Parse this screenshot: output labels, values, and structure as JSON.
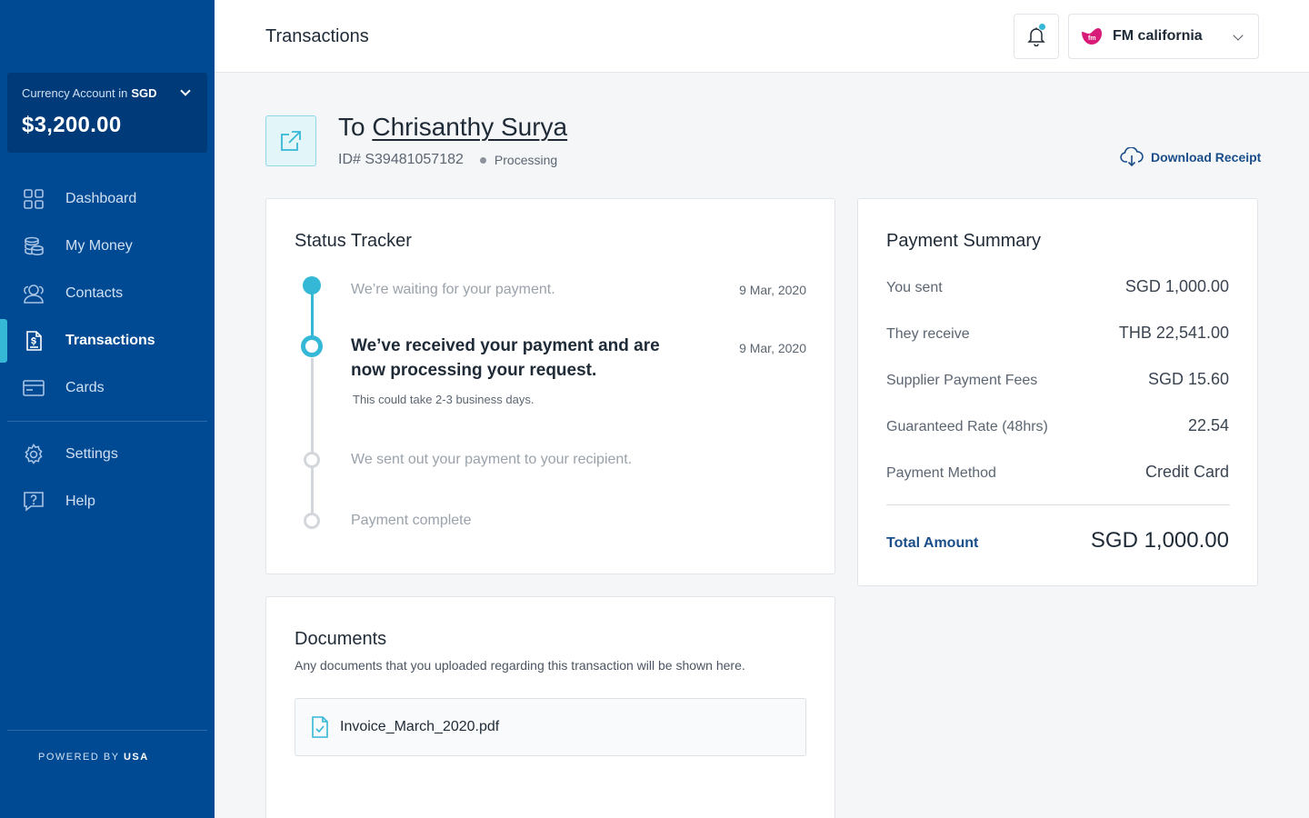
{
  "sidebar": {
    "account_label": "Currency Account in",
    "account_currency": "SGD",
    "balance": "$3,200.00",
    "items": [
      {
        "label": "Dashboard",
        "icon": "dashboard-icon"
      },
      {
        "label": "My Money",
        "icon": "coins-icon"
      },
      {
        "label": "Contacts",
        "icon": "contacts-icon"
      },
      {
        "label": "Transactions",
        "icon": "transactions-icon",
        "active": true
      },
      {
        "label": "Cards",
        "icon": "card-icon"
      },
      {
        "label": "Settings",
        "icon": "gear-icon"
      },
      {
        "label": "Help",
        "icon": "help-icon"
      }
    ],
    "powered_by": "POWERED BY",
    "powered_brand": "USA"
  },
  "header": {
    "title": "Transactions",
    "org_name": "FM california"
  },
  "transaction": {
    "to_prefix": "To",
    "recipient": "Chrisanthy Surya",
    "id": "ID# S39481057182",
    "status": "Processing",
    "download_label": "Download Receipt"
  },
  "tracker": {
    "title": "Status Tracker",
    "steps": [
      {
        "text": "We’re waiting for your payment.",
        "date": "9 Mar, 2020",
        "state": "done"
      },
      {
        "text": "We’ve received your payment and are now processing your request.",
        "date": "9 Mar, 2020",
        "sub": "This could take 2-3 business days.",
        "state": "active"
      },
      {
        "text": "We sent out your payment to your recipient.",
        "state": "pending"
      },
      {
        "text": "Payment complete",
        "state": "pending"
      }
    ]
  },
  "documents": {
    "title": "Documents",
    "description": "Any documents that you uploaded regarding this transaction will be shown here.",
    "files": [
      "Invoice_March_2020.pdf"
    ]
  },
  "summary": {
    "title": "Payment Summary",
    "rows": [
      {
        "label": "You sent",
        "value": "SGD 1,000.00"
      },
      {
        "label": "They receive",
        "value": "THB 22,541.00"
      },
      {
        "label": "Supplier Payment Fees",
        "value": "SGD 15.60"
      },
      {
        "label": "Guaranteed Rate (48hrs)",
        "value": "22.54"
      },
      {
        "label": "Payment Method",
        "value": "Credit Card"
      }
    ],
    "total_label": "Total Amount",
    "total_value": "SGD 1,000.00"
  },
  "colors": {
    "sidebar": "#004a93",
    "accent": "#35b8d6",
    "link": "#1a4e8a"
  }
}
